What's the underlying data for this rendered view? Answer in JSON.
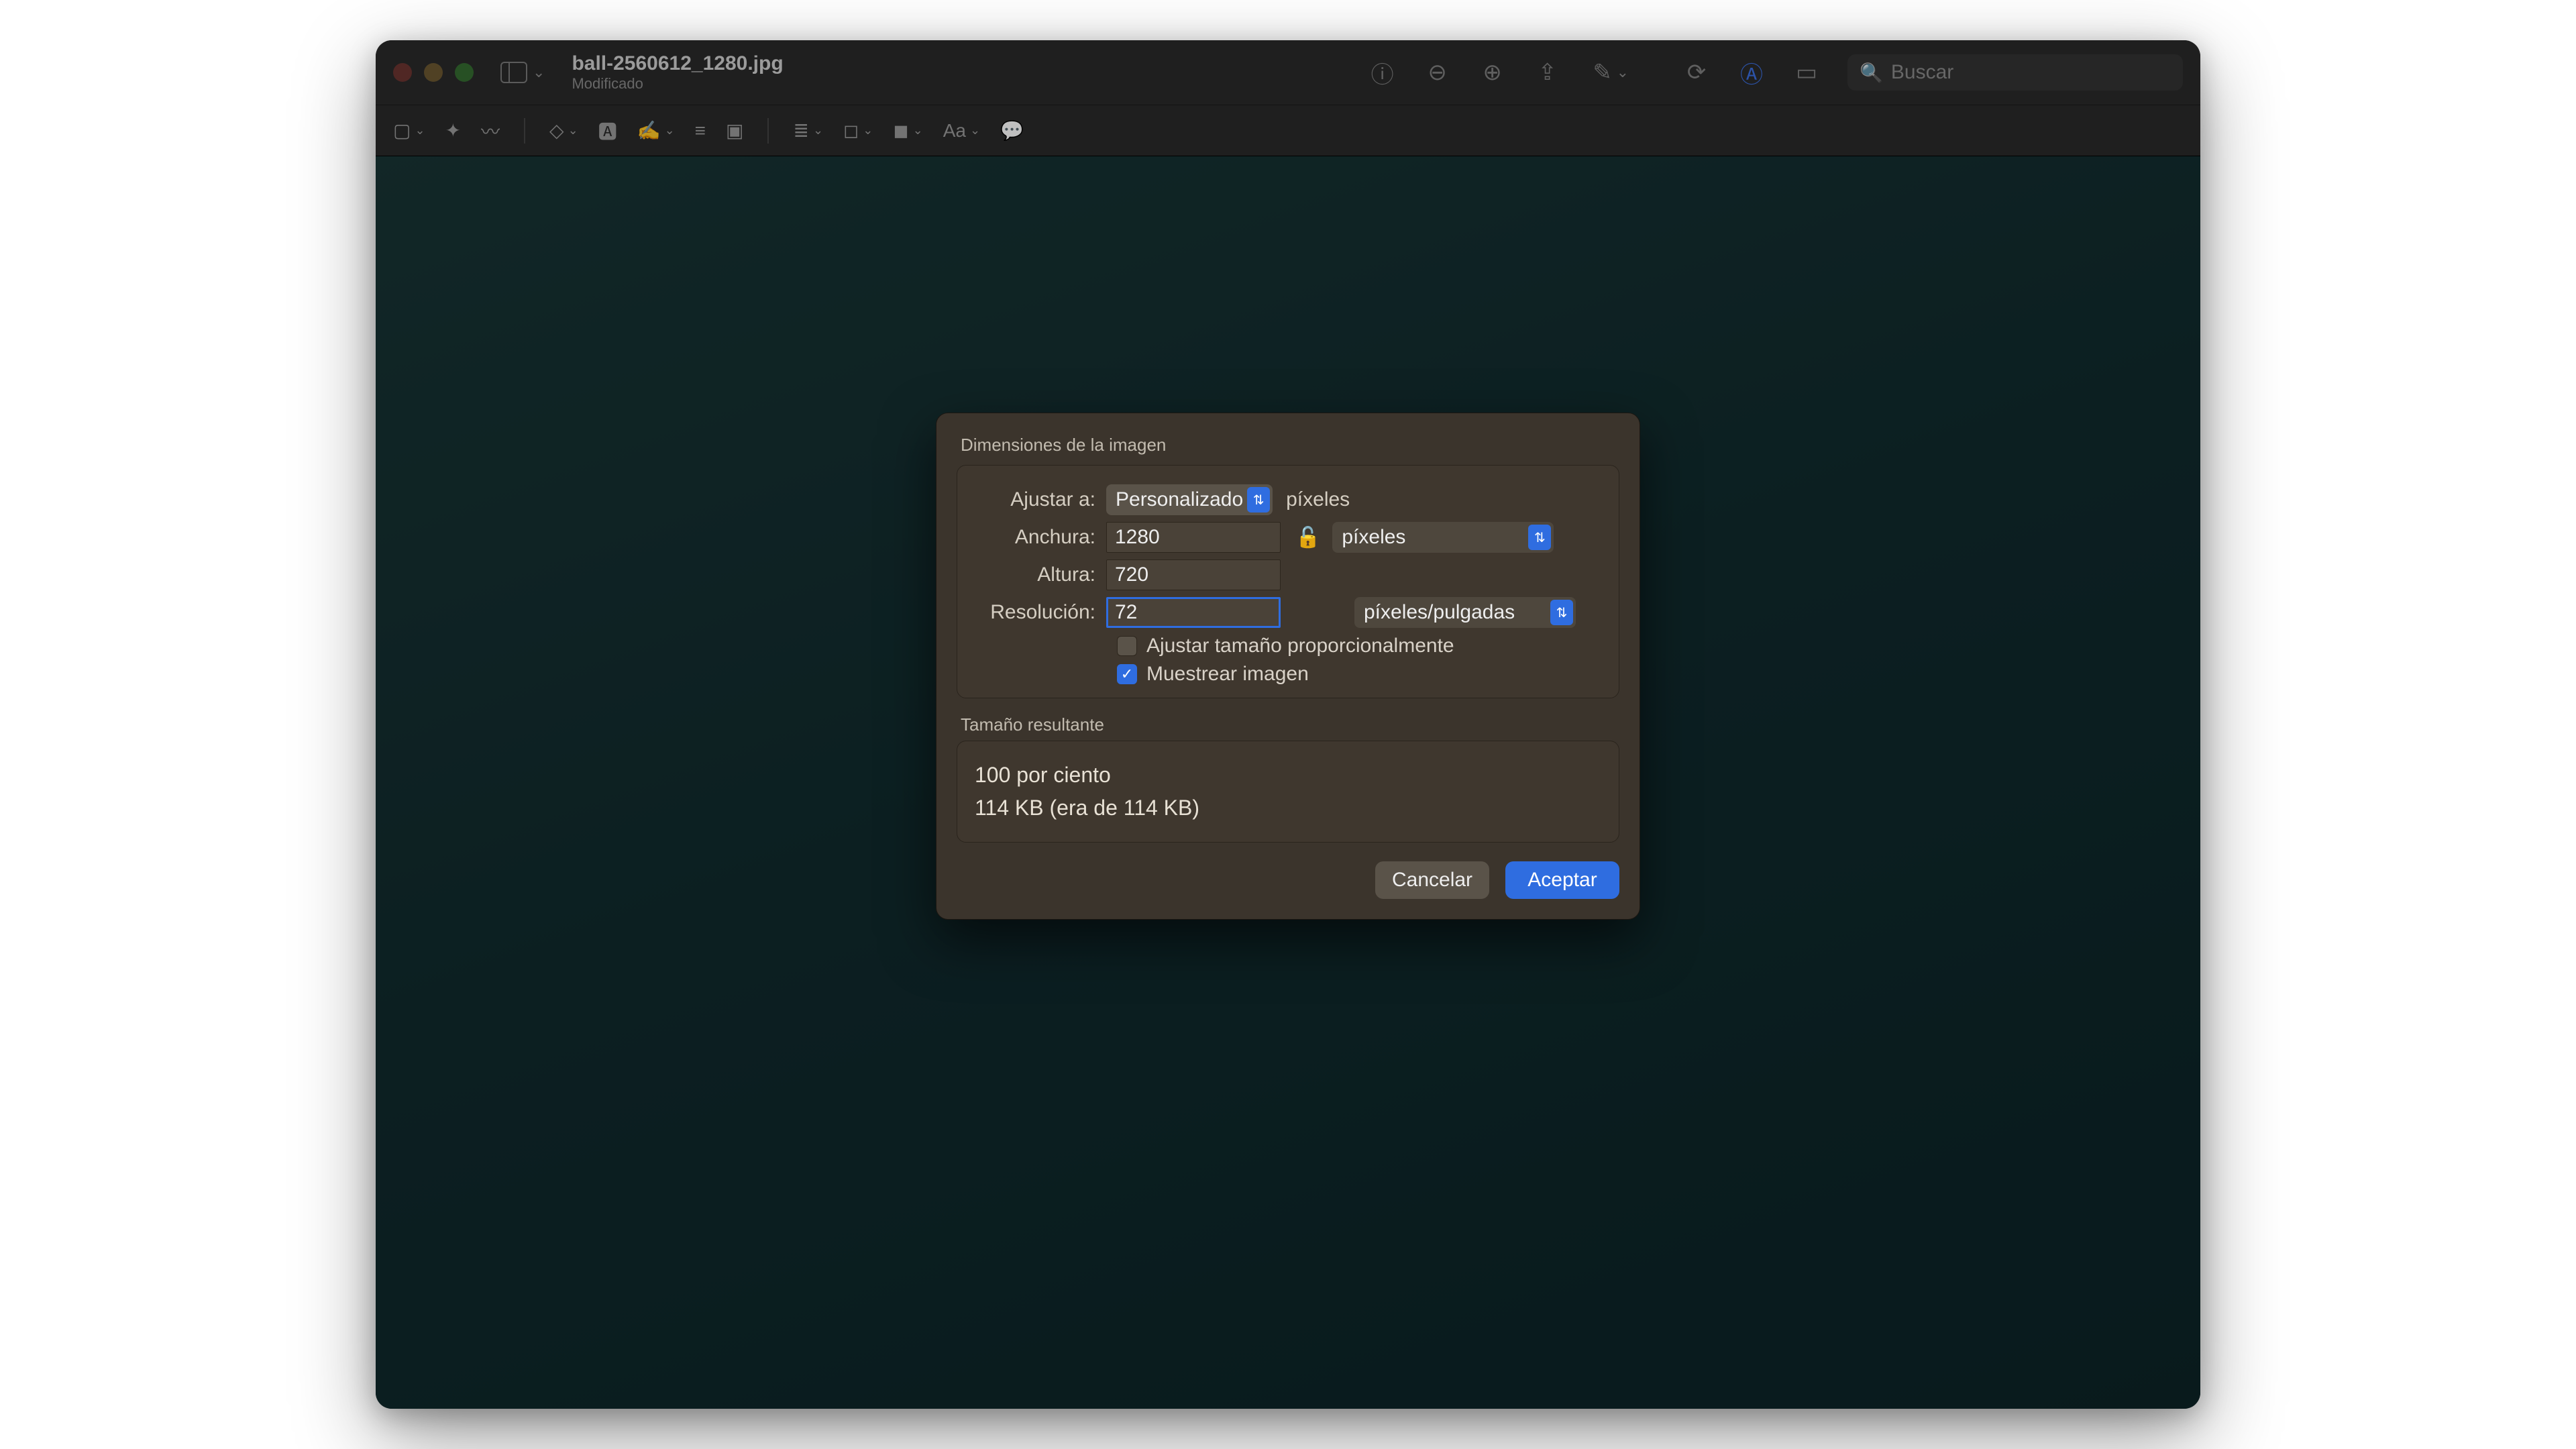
{
  "window": {
    "title": "ball-2560612_1280.jpg",
    "subtitle": "Modificado"
  },
  "search": {
    "placeholder": "Buscar"
  },
  "modal": {
    "heading": "Dimensiones de la imagen",
    "fit_label": "Ajustar a:",
    "fit_value": "Personalizado",
    "fit_unit": "píxeles",
    "width_label": "Anchura:",
    "width_value": "1280",
    "height_label": "Altura:",
    "height_value": "720",
    "dim_unit": "píxeles",
    "res_label": "Resolución:",
    "res_value": "72",
    "res_unit": "píxeles/pulgadas",
    "cb_scale": "Ajustar tamaño proporcionalmente",
    "cb_resample": "Muestrear imagen",
    "result_heading": "Tamaño resultante",
    "result_percent": "100 por ciento",
    "result_size": "114 KB (era de 114 KB)",
    "cancel": "Cancelar",
    "ok": "Aceptar"
  }
}
